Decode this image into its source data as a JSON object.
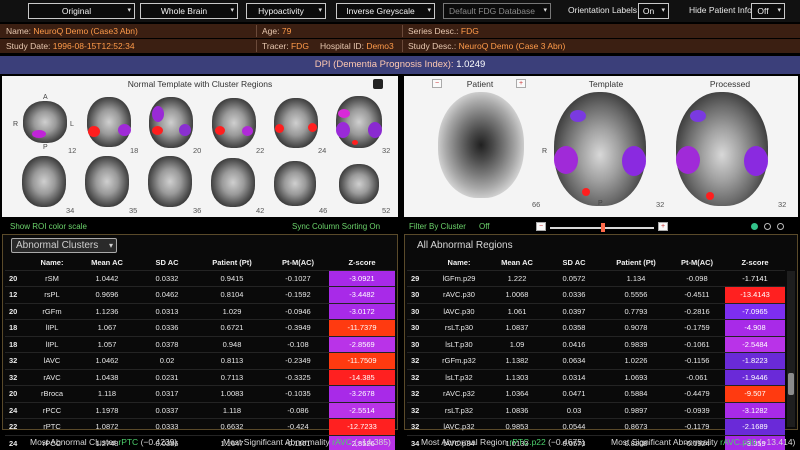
{
  "toolbar": {
    "image_type": "Original",
    "region": "Whole Brain",
    "analysis": "Hypoactivity",
    "colormap": "Inverse Greyscale",
    "database": "Default FDG Database",
    "orientation_label": "Orientation Labels",
    "orientation_value": "On",
    "hide_label": "Hide Patient Info",
    "hide_value": "Off"
  },
  "info": {
    "name_k": "Name:",
    "name_v": "NeuroQ Demo (Case3 Abn)",
    "age_k": "Age:",
    "age_v": "79",
    "series_k": "Series Desc.:",
    "series_v": "FDG",
    "date_k": "Study Date:",
    "date_v": "1996-08-15T12:52:34",
    "tracer_k": "Tracer:",
    "tracer_v": "FDG",
    "hosp_k": "Hospital ID:",
    "hosp_v": "Demo3",
    "study_k": "Study Desc.:",
    "study_v": "NeuroQ Demo (Case 3 Abn)"
  },
  "dpi": {
    "label": "DPI (Dementia Prognosis Index):",
    "value": "1.0249"
  },
  "template_panel": {
    "title": "Normal Template with Cluster Regions",
    "orient": {
      "top": "A",
      "left": "R",
      "right": "L",
      "bottom": "P"
    },
    "slice_numbers": [
      "12",
      "18",
      "20",
      "22",
      "24",
      "32",
      "34",
      "35",
      "36",
      "42",
      "46",
      "52"
    ]
  },
  "views": {
    "patient": "Patient",
    "template": "Template",
    "processed": "Processed",
    "minus": "−",
    "plus": "+",
    "slice_left": "66",
    "slice_template": "32",
    "slice_processed": "32",
    "orient_r": "R",
    "orient_p": "P"
  },
  "controls": {
    "roi_scale": "Show ROI color scale",
    "sync": "Sync Column Sorting On",
    "filter": "Filter By Cluster",
    "filter_state": "Off",
    "minus": "−",
    "plus": "+"
  },
  "clusters": {
    "dropdown": "Abnormal Clusters",
    "headers": [
      "Name:",
      "Mean AC",
      "SD AC",
      "Patient (Pt)",
      "Pt-M(AC)",
      "Z-score"
    ],
    "rows": [
      [
        "20",
        "rSM",
        "1.0442",
        "0.0332",
        "0.9415",
        "-0.1027",
        "-3.0921"
      ],
      [
        "12",
        "rsPL",
        "0.9696",
        "0.0462",
        "0.8104",
        "-0.1592",
        "-3.4482"
      ],
      [
        "20",
        "rGFm",
        "1.1236",
        "0.0313",
        "1.029",
        "-0.0946",
        "-3.0172"
      ],
      [
        "18",
        "lIPL",
        "1.067",
        "0.0336",
        "0.6721",
        "-0.3949",
        "-11.7379"
      ],
      [
        "18",
        "lIPL",
        "1.057",
        "0.0378",
        "0.948",
        "-0.108",
        "-2.8569"
      ],
      [
        "32",
        "lAVC",
        "1.0462",
        "0.02",
        "0.8113",
        "-0.2349",
        "-11.7509"
      ],
      [
        "32",
        "rAVC",
        "1.0438",
        "0.0231",
        "0.7113",
        "-0.3325",
        "-14.385"
      ],
      [
        "20",
        "rBroca",
        "1.118",
        "0.0317",
        "1.0083",
        "-0.1035",
        "-3.2678"
      ],
      [
        "24",
        "rPCC",
        "1.1978",
        "0.0337",
        "1.118",
        "-0.086",
        "-2.5514"
      ],
      [
        "22",
        "rPTC",
        "1.0872",
        "0.0333",
        "0.6632",
        "-0.424",
        "-12.7233"
      ],
      [
        "24",
        "rPCC",
        "1.2748",
        "0.0386",
        "1.1647",
        "-0.1101",
        "-2.8526"
      ]
    ],
    "footer_label1": "Most Abnormal Cluster",
    "footer_value1": "rPTC",
    "footer_num1": "(−0.4239)",
    "footer_label2": "Most Significant Abnormality",
    "footer_value2": "rAVC",
    "footer_num2": "(−14.385)"
  },
  "regions": {
    "title": "All Abnormal Regions",
    "headers": [
      "Name:",
      "Mean AC",
      "SD AC",
      "Patient (Pt)",
      "Pt-M(AC)",
      "Z-score"
    ],
    "rows": [
      [
        "29",
        "lGFm.p29",
        "1.222",
        "0.0572",
        "1.134",
        "-0.098",
        "-1.7141"
      ],
      [
        "30",
        "rAVC.p30",
        "1.0068",
        "0.0336",
        "0.5556",
        "-0.4511",
        "-13.4143"
      ],
      [
        "30",
        "lAVC.p30",
        "1.061",
        "0.0397",
        "0.7793",
        "-0.2816",
        "-7.0965"
      ],
      [
        "30",
        "rsLT.p30",
        "1.0837",
        "0.0358",
        "0.9078",
        "-0.1759",
        "-4.908"
      ],
      [
        "30",
        "lsLT.p30",
        "1.09",
        "0.0416",
        "0.9839",
        "-0.1061",
        "-2.5484"
      ],
      [
        "32",
        "rGFm.p32",
        "1.1382",
        "0.0634",
        "1.0226",
        "-0.1156",
        "-1.8223"
      ],
      [
        "32",
        "lsLT.p32",
        "1.1303",
        "0.0314",
        "1.0693",
        "-0.061",
        "-1.9446"
      ],
      [
        "32",
        "rAVC.p32",
        "1.0364",
        "0.0471",
        "0.5884",
        "-0.4479",
        "-9.507"
      ],
      [
        "32",
        "rsLT.p32",
        "1.0836",
        "0.03",
        "0.9897",
        "-0.0939",
        "-3.1282"
      ],
      [
        "32",
        "lAVC.p32",
        "0.9853",
        "0.0544",
        "0.8673",
        "-0.1179",
        "-2.1689"
      ],
      [
        "34",
        "lAVC.p34",
        "1.0133",
        "0.0573",
        "0.8208",
        "-0.1924",
        "-3.359"
      ]
    ],
    "footer_label1": "Most Abnormal Region",
    "footer_value1": "rPTC.p22",
    "footer_num1": "(−0.4675)",
    "footer_label2": "Most Significant Abnormality",
    "footer_value2": "rAVC.p30",
    "footer_num2": "(−13.414)"
  }
}
